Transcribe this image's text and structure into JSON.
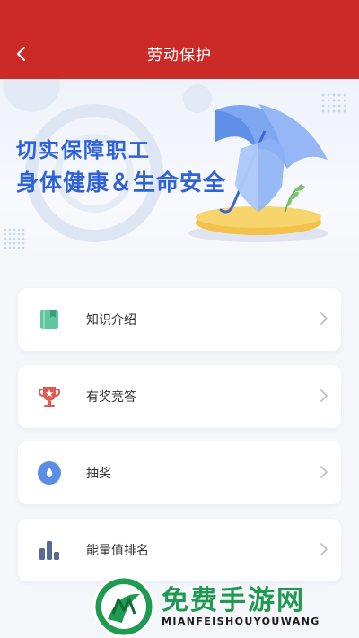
{
  "header": {
    "title": "劳动保护",
    "back_icon": "chevron-left-icon"
  },
  "banner": {
    "line1": "切实保障职工",
    "line2": "身体健康＆生命安全"
  },
  "menu": {
    "items": [
      {
        "label": "知识介绍",
        "icon": "book-icon",
        "color": "#5fc6a0"
      },
      {
        "label": "有奖竞答",
        "icon": "trophy-icon",
        "color": "#e5564e"
      },
      {
        "label": "抽奖",
        "icon": "lottery-icon",
        "color": "#5b8de6"
      },
      {
        "label": "能量值排名",
        "icon": "ranking-bars-icon",
        "color": "#5a6a96"
      }
    ]
  },
  "watermark": {
    "title": "免费手游网",
    "subtitle": "MIANFEISHOUYOUWANG"
  },
  "colors": {
    "header": "#cc2a26",
    "banner_text": "#2f62d8",
    "watermark": "#1f9a52"
  }
}
